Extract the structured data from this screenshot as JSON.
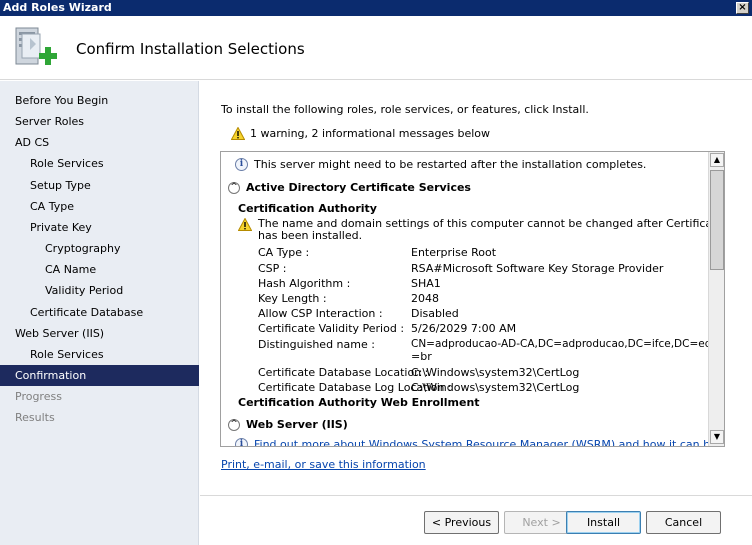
{
  "window": {
    "title": "Add Roles Wizard",
    "close_glyph": "×"
  },
  "header": {
    "title": "Confirm Installation Selections",
    "icon": "server-add-icon"
  },
  "sidebar": {
    "items": [
      {
        "label": "Before You Begin",
        "state": "normal"
      },
      {
        "label": "Server Roles",
        "state": "normal"
      },
      {
        "label": "AD CS",
        "state": "normal"
      },
      {
        "label": "Role Services",
        "state": "normal"
      },
      {
        "label": "Setup Type",
        "state": "normal"
      },
      {
        "label": "CA Type",
        "state": "normal"
      },
      {
        "label": "Private Key",
        "state": "normal"
      },
      {
        "label": "Cryptography",
        "state": "normal"
      },
      {
        "label": "CA Name",
        "state": "normal"
      },
      {
        "label": "Validity Period",
        "state": "normal"
      },
      {
        "label": "Certificate Database",
        "state": "normal"
      },
      {
        "label": "Web Server (IIS)",
        "state": "normal"
      },
      {
        "label": "Role Services",
        "state": "normal"
      },
      {
        "label": "Confirmation",
        "state": "active"
      },
      {
        "label": "Progress",
        "state": "dim"
      },
      {
        "label": "Results",
        "state": "dim"
      }
    ]
  },
  "main": {
    "intro": "To install the following roles, role services, or features, click Install.",
    "warning_summary": "1 warning, 2 informational messages below",
    "panel": {
      "restart_note": "This server might need to be restarted after the installation completes.",
      "adcs_header": "Active Directory Certificate Services",
      "ca_subheader": "Certification Authority",
      "ca_warning_line1": "The name and domain settings of this computer cannot be changed after Certification Authority",
      "ca_warning_line2": "has been installed.",
      "fields": [
        {
          "key": "CA Type :",
          "value": "Enterprise Root"
        },
        {
          "key": "CSP :",
          "value": "RSA#Microsoft Software Key Storage Provider"
        },
        {
          "key": "Hash Algorithm :",
          "value": "SHA1"
        },
        {
          "key": "Key Length :",
          "value": "2048"
        },
        {
          "key": "Allow CSP Interaction :",
          "value": "Disabled"
        },
        {
          "key": "Certificate Validity Period :",
          "value": "5/26/2029 7:00 AM"
        },
        {
          "key": "Distinguished name :",
          "value": "CN=adproducao-AD-CA,DC=adproducao,DC=ifce,DC=edu,DC",
          "value2": "=br"
        },
        {
          "key": "Certificate Database Location :",
          "value": "C:\\Windows\\system32\\CertLog"
        },
        {
          "key": "Certificate Database Log Location :",
          "value": "C:\\Windows\\system32\\CertLog"
        }
      ],
      "web_enrollment": "Certification Authority Web Enrollment",
      "iis_header": "Web Server (IIS)",
      "iis_cut_text": "Find out more about Windows System Resource Manager (WSRM) and how it can help optimize"
    },
    "link": "Print, e-mail, or save this information"
  },
  "buttons": {
    "previous": "< Previous",
    "next": "Next >",
    "install": "Install",
    "cancel": "Cancel"
  },
  "colors": {
    "titlebar": "#0b2b6e",
    "sidebar_bg": "#e9edf3",
    "active_nav": "#1d2a5e",
    "link": "#0645ad"
  }
}
